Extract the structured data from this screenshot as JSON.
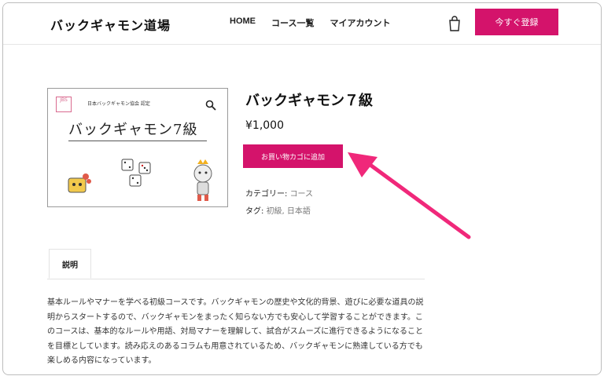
{
  "header": {
    "logo": "バックギャモン道場",
    "nav": [
      "HOME",
      "コース一覧",
      "マイアカウント"
    ],
    "register_label": "今すぐ登録"
  },
  "product_image": {
    "org_text": "日本バックギャモン協会 認定",
    "title": "バックギャモン7級",
    "badge": "JBS"
  },
  "product": {
    "title": "バックギャモン７級",
    "price": "¥1,000",
    "add_to_cart_label": "お買い物カゴに追加",
    "category_label": "カテゴリー:",
    "category_value": "コース",
    "tag_label": "タグ:",
    "tag_value": "初級, 日本語"
  },
  "tabs": {
    "description_label": "説明"
  },
  "description_text": "基本ルールやマナーを学べる初級コースです。バックギャモンの歴史や文化的背景、遊びに必要な道具の説明からスタートするので、バックギャモンをまったく知らない方でも安心して学習することができます。このコースは、基本的なルールや用語、対局マナーを理解して、試合がスムーズに進行できるようになることを目標としています。読み応えのあるコラムも用意されているため、バックギャモンに熟達している方でも楽しめる内容になっています。",
  "colors": {
    "accent": "#d4136b",
    "arrow": "#f0287a"
  }
}
